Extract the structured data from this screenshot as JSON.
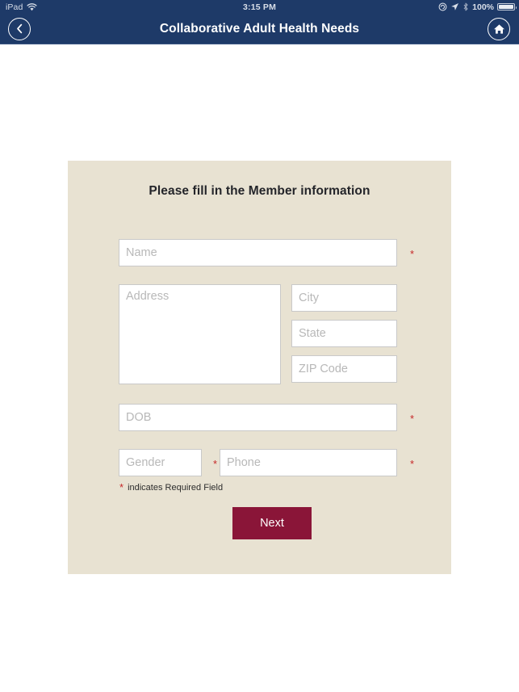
{
  "status_bar": {
    "carrier": "iPad",
    "wifi_icon": "wifi-icon",
    "time": "3:15 PM",
    "rotation_lock_icon": "rotation-lock-icon",
    "location_icon": "location-arrow-icon",
    "bluetooth_icon": "bluetooth-icon",
    "battery_percent": "100%",
    "battery_icon": "battery-full-icon"
  },
  "nav_bar": {
    "back_icon": "chevron-left-circle-icon",
    "title": "Collaborative Adult Health Needs",
    "home_icon": "home-circle-icon",
    "background_color": "#1e3a68"
  },
  "card": {
    "background_color": "#e8e2d2",
    "title": "Please fill in the Member information",
    "fields": {
      "name": {
        "placeholder": "Name",
        "value": "",
        "required": true
      },
      "address": {
        "placeholder": "Address",
        "value": "",
        "required": false
      },
      "city": {
        "placeholder": "City",
        "value": "",
        "required": false
      },
      "state": {
        "placeholder": "State",
        "value": "",
        "required": false
      },
      "zip": {
        "placeholder": "ZIP Code",
        "value": "",
        "required": false
      },
      "dob": {
        "placeholder": "DOB",
        "value": "",
        "required": true
      },
      "gender": {
        "placeholder": "Gender",
        "value": "",
        "required": true
      },
      "phone": {
        "placeholder": "Phone",
        "value": "",
        "required": true
      }
    },
    "required_marker": "*",
    "required_note": "indicates Required Field",
    "next_label": "Next",
    "next_color": "#8a1538",
    "required_color": "#c62828"
  }
}
